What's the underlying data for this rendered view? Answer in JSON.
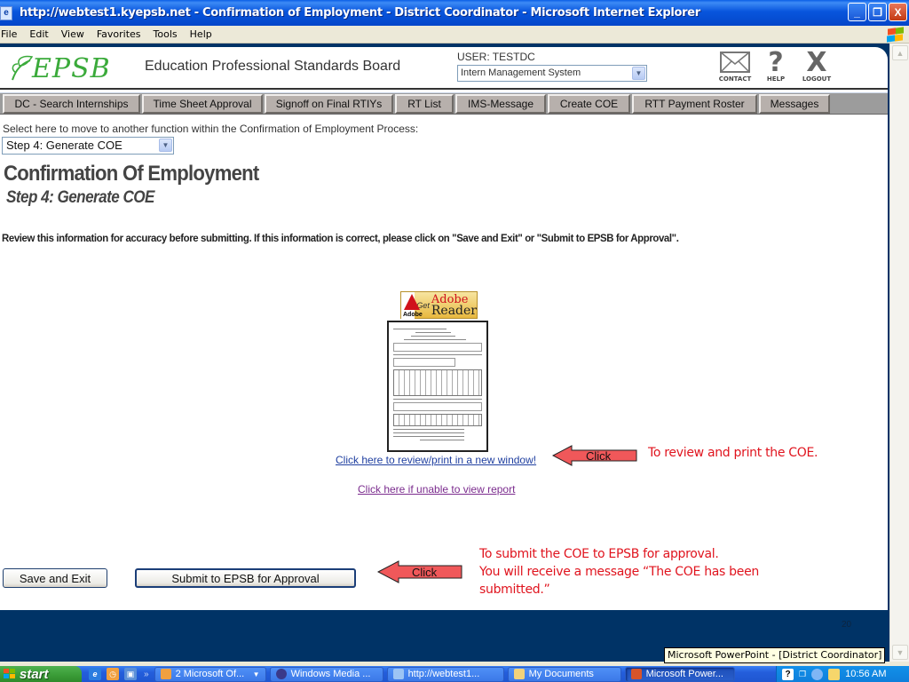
{
  "window": {
    "title": "http://webtest1.kyepsb.net - Confirmation of Employment - District Coordinator - Microsoft Internet Explorer",
    "controls": {
      "minimize": "_",
      "restore": "❐",
      "close": "X"
    }
  },
  "menu": [
    "File",
    "Edit",
    "View",
    "Favorites",
    "Tools",
    "Help"
  ],
  "header": {
    "logo_text": "EPSB",
    "org_name": "Education Professional Standards Board",
    "user_label": "USER: TESTDC",
    "system_select": {
      "value": "Intern Management System"
    },
    "icons": [
      {
        "name": "contact",
        "label": "CONTACT"
      },
      {
        "name": "help",
        "label": "HELP"
      },
      {
        "name": "logout",
        "label": "LOGOUT"
      }
    ]
  },
  "nav": {
    "tabs": [
      "DC - Search Internships",
      "Time Sheet Approval",
      "Signoff on Final RTIYs",
      "RT List",
      "IMS-Message",
      "Create COE",
      "RTT Payment Roster",
      "Messages"
    ]
  },
  "main": {
    "select_label": "Select here to move to another function within the Confirmation of Employment Process:",
    "step_select": {
      "value": "Step 4: Generate COE"
    },
    "title": "Confirmation Of Employment",
    "subtitle": "Step 4: Generate COE",
    "instructions": "Review this information for accuracy before submitting. If this information is correct, please click on \"Save and Exit\" or \"Submit to EPSB for Approval\".",
    "adobe_badge": {
      "brand": "Adobe",
      "get": "Get",
      "line1": "Adobe",
      "line2": "Reader"
    },
    "review_link": "Click here to review/print in a new window!",
    "unable_link": "Click here if unable to view report",
    "buttons": {
      "save_exit": "Save and Exit",
      "submit": "Submit to EPSB for Approval"
    }
  },
  "annotations": {
    "arrow_label": "Click",
    "review_note": "To review and print the COE.",
    "submit_note_lines": [
      "To submit the COE to EPSB for approval.",
      "You will receive a message “The COE has been",
      "submitted.”"
    ],
    "colors": {
      "note_text": "#e0141e",
      "arrow_fill": "#f0585a"
    }
  },
  "slide_number": "20",
  "tooltip": "Microsoft PowerPoint - [District Coordinator]",
  "taskbar": {
    "start_label": "start",
    "chevron": "»",
    "tasks": [
      {
        "label": "2 Microsoft Of...",
        "active": false
      },
      {
        "label": "Windows Media ...",
        "active": false
      },
      {
        "label": "http://webtest1...",
        "active": false
      },
      {
        "label": "My Documents",
        "active": false
      },
      {
        "label": "Microsoft Power...",
        "active": true
      }
    ],
    "clock": "10:56 AM"
  }
}
